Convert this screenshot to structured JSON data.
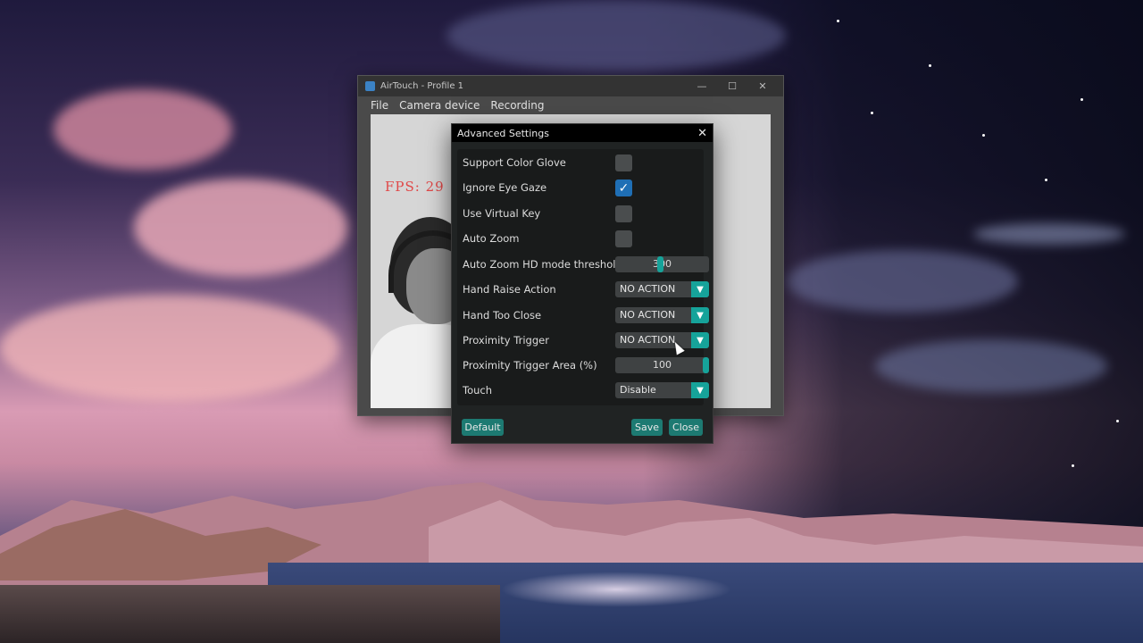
{
  "window": {
    "title": "AirTouch - Profile 1",
    "controls": {
      "minimize": "—",
      "maximize": "☐",
      "close": "✕"
    }
  },
  "menu": {
    "items": [
      "File",
      "Camera device",
      "Recording"
    ]
  },
  "camera": {
    "fps_text": "FPS: 29"
  },
  "dialog": {
    "title": "Advanced Settings",
    "close_glyph": "✕",
    "settings": {
      "support_color_glove": {
        "label": "Support Color Glove",
        "checked": false
      },
      "ignore_eye_gaze": {
        "label": "Ignore Eye Gaze",
        "checked": true
      },
      "use_virtual_key": {
        "label": "Use Virtual Key",
        "checked": false
      },
      "auto_zoom": {
        "label": "Auto Zoom",
        "checked": false
      },
      "auto_zoom_hd_threshold": {
        "label": "Auto Zoom HD mode threshold",
        "value": "300",
        "slider_fraction": 0.48
      },
      "hand_raise_action": {
        "label": "Hand Raise Action",
        "value": "NO ACTION"
      },
      "hand_too_close": {
        "label": "Hand Too Close",
        "value": "NO ACTION"
      },
      "proximity_trigger": {
        "label": "Proximity Trigger",
        "value": "NO ACTION"
      },
      "proximity_trigger_area": {
        "label": "Proximity Trigger Area (%)",
        "value": "100",
        "slider_fraction": 1.0
      },
      "touch": {
        "label": "Touch",
        "value": "Disable"
      }
    },
    "buttons": {
      "default": "Default",
      "save": "Save",
      "close": "Close"
    }
  },
  "colors": {
    "accent": "#16a39a",
    "button": "#1d7a72",
    "check": "#1f6fb5",
    "fps": "#e04848"
  },
  "icons": {
    "dropdown": "chevron-down-icon",
    "check": "checkmark-icon",
    "app": "airtouch-app-icon"
  }
}
